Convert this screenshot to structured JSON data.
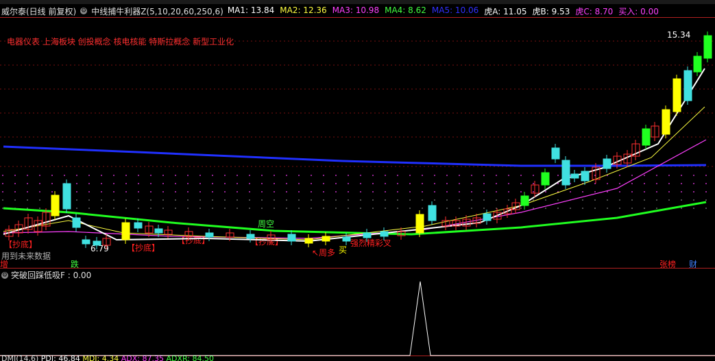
{
  "header": {
    "stock_name": "威尔泰(日线 前复权)",
    "indicator_name": "中线捕牛利器Z(5,10,20,60,250,6)",
    "ma_values": [
      {
        "label": "MA1: 13.84",
        "color": "#ffffff"
      },
      {
        "label": "MA2: 12.36",
        "color": "#ffff40"
      },
      {
        "label": "MA3: 10.98",
        "color": "#ff40ff"
      },
      {
        "label": "MA4: 8.62",
        "color": "#40ff40"
      },
      {
        "label": "MA5: 10.06",
        "color": "#3030ff"
      }
    ],
    "tiger_values": [
      {
        "label": "虎A: 11.05",
        "color": "#ffffff"
      },
      {
        "label": "虎B: 9.53",
        "color": "#ffffff"
      },
      {
        "label": "虎C: 8.70",
        "color": "#ff40ff"
      },
      {
        "label": "买入: 0.00",
        "color": "#ff40ff"
      }
    ]
  },
  "concepts": "电器仪表 上海板块 创投概念 核电核能 特斯拉概念 新型工业化",
  "price_labels": {
    "high": "15.34",
    "low": "6.79"
  },
  "signals": {
    "chaodi": [
      "【抄底】",
      "【抄底】",
      "【抄底】",
      "【抄底】"
    ],
    "zhoukong": "周空",
    "zhouduo": "↖周多",
    "mai": "买",
    "jin_cha": "强烈精彩叉",
    "zeng": "增",
    "die": "跌",
    "future_data": "用到未来数据",
    "zhangbang": "张榜",
    "cai": "财"
  },
  "sub_indicator": {
    "label": "突破回踩低吸F : 0.00"
  },
  "bottom": {
    "dmi": "DMI(14,6)",
    "pdi": "PDI: 46.84",
    "mdi": "MDI: 4.34",
    "adx": "ADX: 87.35",
    "adxr": "ADXR: 84.50"
  },
  "colors": {
    "up": "#ff3030",
    "down": "#40e0e0",
    "strong": "#ffff00",
    "green": "#20ff20"
  }
}
